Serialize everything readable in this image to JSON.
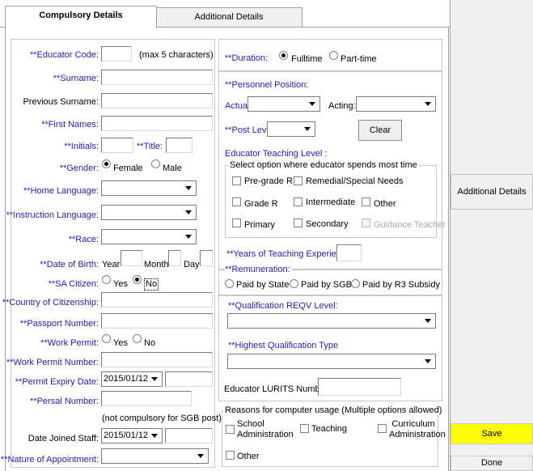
{
  "tabs": [
    {
      "label": "Compulsory Details"
    },
    {
      "label": "Additional Details"
    }
  ],
  "left": {
    "educator_code": {
      "label": "**Educator Code:",
      "value": "",
      "hint": "(max 5 characters)"
    },
    "surname": {
      "label": "**Surname:",
      "value": ""
    },
    "previous_surname": {
      "label": "Previous Surname:",
      "value": ""
    },
    "first_names": {
      "label": "**First Names:",
      "value": ""
    },
    "initials": {
      "label": "**Initials:",
      "value": ""
    },
    "title": {
      "label": "**Title:",
      "value": ""
    },
    "gender": {
      "label": "**Gender:",
      "options": [
        "Female",
        "Male"
      ],
      "selected": "Female"
    },
    "home_language": {
      "label": "**Home Language:",
      "value": ""
    },
    "instruction_language": {
      "label": "**Instruction Language:",
      "value": ""
    },
    "race": {
      "label": "**Race:",
      "value": ""
    },
    "date_of_birth": {
      "label": "**Date of Birth:",
      "year_label": "Year",
      "month_label": "Month",
      "day_label": "Day"
    },
    "sa_citizen": {
      "label": "**SA Citizen:",
      "options": [
        "Yes",
        "No"
      ],
      "selected": "No"
    },
    "country_of_citizenship": {
      "label": "**Country of Citizenship:",
      "value": ""
    },
    "passport_number": {
      "label": "**Passport Number:",
      "value": ""
    },
    "work_permit": {
      "label": "**Work Permit:",
      "options": [
        "Yes",
        "No"
      ],
      "selected": ""
    },
    "work_permit_number": {
      "label": "**Work Permit Number:",
      "value": ""
    },
    "permit_expiry_date": {
      "label": "**Permit Expiry Date:",
      "value": "2015/01/12"
    },
    "persal_number": {
      "label": "**Persal Number:",
      "value": "",
      "note": "(not compulsory for SGB post)"
    },
    "date_joined_staff": {
      "label": "Date Joined Staff:",
      "value": "2015/01/12"
    },
    "nature_of_appointment": {
      "label": "**Nature of Appointment:",
      "value": ""
    }
  },
  "right": {
    "duration": {
      "label": "**Duration:",
      "options": [
        "Fulltime",
        "Part-time"
      ],
      "selected": "Fulltime"
    },
    "personnel_position": {
      "label": "**Personnel Position:",
      "actual_label": "Actual:",
      "acting_label": "Acting:"
    },
    "post_level": {
      "label": "**Post Level:"
    },
    "clear_label": "Clear",
    "teaching_level": {
      "label": "Educator Teaching Level :",
      "group_title": "Select option where educator spends most time",
      "options": [
        "Pre-grade R",
        "Remedial/Special Needs",
        "Grade R",
        "Intermediate",
        "Other",
        "Primary",
        "Secondary",
        "Guidance Teacher"
      ]
    },
    "years_experience": {
      "label": "**Years of Teaching Experience:",
      "value": ""
    },
    "remuneration": {
      "label": "**Remuneration:",
      "options": [
        "Paid by State",
        "Paid by SGB",
        "Paid by R3 Subsidy"
      ],
      "selected": ""
    },
    "qualification_reqv": {
      "label": "**Qualification REQV Level:"
    },
    "highest_qualification": {
      "label": "**Highest Qualification Type"
    },
    "lurits_number": {
      "label": "Educator LURITS Number:",
      "value": ""
    },
    "computer_usage": {
      "title": "Reasons for computer usage (Multiple options allowed)",
      "options": [
        "School Administration",
        "Teaching",
        "Curriculum Administration",
        "Other"
      ]
    }
  },
  "side": {
    "additional_details_label": "Additional Details",
    "save_label": "Save",
    "done_label": "Done"
  },
  "colors": {
    "required": "#1d1db8",
    "save_bg": "#ffff00",
    "panel_bg": "#f0f0f0"
  }
}
